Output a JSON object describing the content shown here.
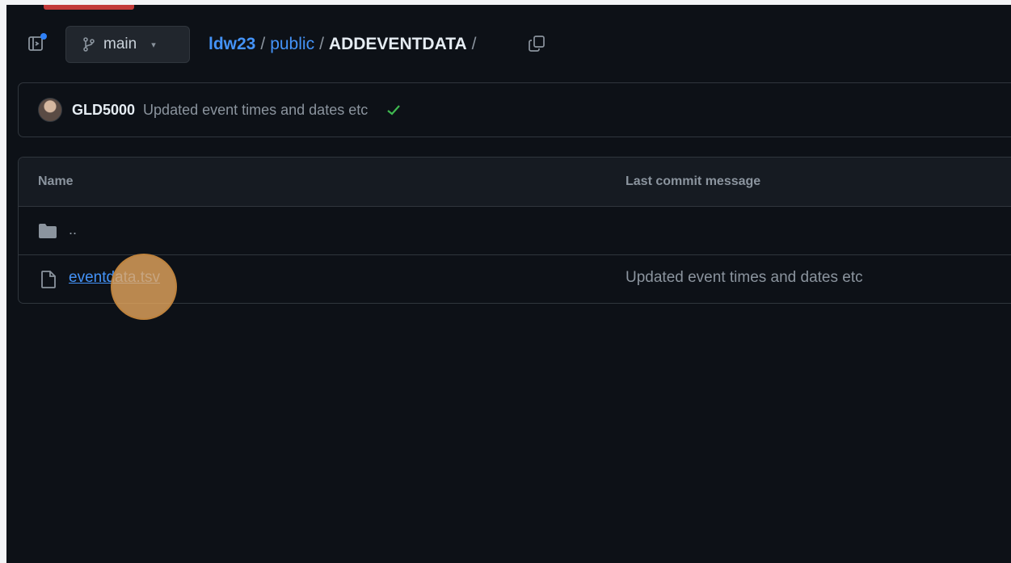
{
  "header": {
    "sidepanel_icon": "sidebar-expand-icon",
    "branch": {
      "icon": "git-branch-icon",
      "label": "main",
      "caret": "▾"
    },
    "breadcrumb": {
      "owner": "ldw23",
      "sep1": "/",
      "folder": "public",
      "sep2": "/",
      "current": "ADDEVENTDATA",
      "sep3": "/"
    },
    "copy_icon": "copy-icon"
  },
  "commit": {
    "author": "GLD5000",
    "message": "Updated event times and dates etc",
    "status_icon": "check-icon",
    "status_color": "#3fb950"
  },
  "table": {
    "columns": {
      "name": "Name",
      "last_commit": "Last commit message"
    },
    "parent_row": {
      "icon": "folder-icon",
      "label": ".."
    },
    "files": [
      {
        "icon": "file-icon",
        "name": "eventdata.tsv",
        "commit_message": "Updated event times and dates etc"
      }
    ]
  },
  "colors": {
    "background": "#0d1117",
    "link": "#4493f8",
    "border": "#30363d",
    "muted": "#8b949e",
    "click_marker": "#eca65f"
  }
}
